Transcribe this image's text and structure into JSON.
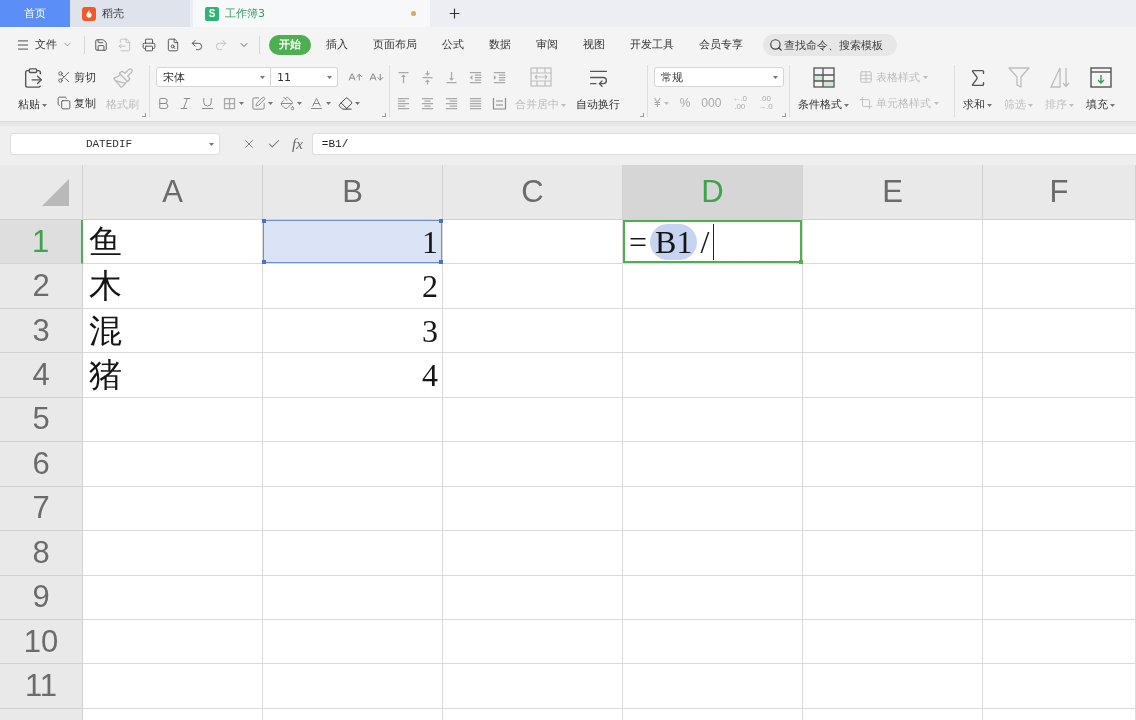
{
  "tabs": [
    {
      "kind": "home",
      "label": "首页",
      "selected": false
    },
    {
      "kind": "docer",
      "label": "稻壳",
      "selected": false
    },
    {
      "kind": "sheet",
      "logo": "S",
      "label": "工作簿3",
      "selected": true,
      "unsaved": true
    }
  ],
  "menu": {
    "file": "文件",
    "quick_access": [
      {
        "kind": "save",
        "disabled": false
      },
      {
        "kind": "export",
        "disabled": true
      },
      {
        "kind": "print",
        "disabled": false
      },
      {
        "kind": "preview",
        "disabled": false
      },
      {
        "kind": "undo",
        "disabled": false
      },
      {
        "kind": "redo",
        "disabled": true
      }
    ],
    "tabs": [
      {
        "label": "开始",
        "selected": true
      },
      {
        "label": "插入",
        "selected": false
      },
      {
        "label": "页面布局",
        "selected": false
      },
      {
        "label": "公式",
        "selected": false
      },
      {
        "label": "数据",
        "selected": false
      },
      {
        "label": "审阅",
        "selected": false
      },
      {
        "label": "视图",
        "selected": false
      },
      {
        "label": "开发工具",
        "selected": false
      },
      {
        "label": "会员专享",
        "selected": false
      }
    ],
    "search": {
      "placeholder": "查找命令、搜索模板"
    }
  },
  "ribbon": {
    "clipboard": [
      {
        "kind": "paste",
        "label": "粘贴",
        "disabled": false
      },
      {
        "kind": "cut",
        "label": "剪切",
        "disabled": false
      },
      {
        "kind": "copy",
        "label": "复制",
        "disabled": false
      },
      {
        "kind": "format_painter",
        "label": "格式刷",
        "disabled": true
      }
    ],
    "font": {
      "name": "宋体",
      "size": "11"
    },
    "alignment": [
      {
        "kind": "merge",
        "label": "合并居中",
        "disabled": true
      },
      {
        "kind": "wrap",
        "label": "自动换行",
        "disabled": false
      }
    ],
    "number": {
      "format": "常规",
      "symbols": [
        {
          "kind": "currency",
          "text": "¥"
        },
        {
          "kind": "percent",
          "text": "%"
        },
        {
          "kind": "thousands",
          "text": "000"
        },
        {
          "kind": "add_decimal",
          "text": "←.0",
          "subtext": ".00"
        },
        {
          "kind": "remove_decimal",
          "text": ".00",
          "subtext": "→.0"
        }
      ]
    },
    "styles": [
      {
        "kind": "conditional",
        "label": "条件格式",
        "disabled": false
      },
      {
        "kind": "table",
        "label": "表格样式",
        "disabled": true
      },
      {
        "kind": "cell",
        "label": "单元格样式",
        "disabled": true
      }
    ],
    "editing": [
      {
        "kind": "sum",
        "label": "求和",
        "disabled": false
      },
      {
        "kind": "filter",
        "label": "筛选",
        "disabled": true
      },
      {
        "kind": "sort",
        "label": "排序",
        "disabled": true
      },
      {
        "kind": "fill",
        "label": "填充",
        "disabled": false
      }
    ]
  },
  "formula_bar": {
    "name_box": "DATEDIF",
    "function_label": "fx",
    "formula": "=B1/"
  },
  "sheet": {
    "columns": [
      {
        "label": "A",
        "selected": false
      },
      {
        "label": "B",
        "selected": false
      },
      {
        "label": "C",
        "selected": false
      },
      {
        "label": "D",
        "selected": true
      },
      {
        "label": "E",
        "selected": false
      },
      {
        "label": "F",
        "selected": false
      }
    ],
    "rows": [
      {
        "label": "1",
        "selected": true,
        "cells": {
          "a": {
            "kind": "text",
            "text": "鱼"
          },
          "b": {
            "kind": "number",
            "text": "1",
            "referenced": true
          }
        }
      },
      {
        "label": "2",
        "selected": false,
        "cells": {
          "a": {
            "kind": "text",
            "text": "木"
          },
          "b": {
            "kind": "number",
            "text": "2",
            "referenced": false
          }
        }
      },
      {
        "label": "3",
        "selected": false,
        "cells": {
          "a": {
            "kind": "text",
            "text": "混"
          },
          "b": {
            "kind": "number",
            "text": "3",
            "referenced": false
          }
        }
      },
      {
        "label": "4",
        "selected": false,
        "cells": {
          "a": {
            "kind": "text",
            "text": "猪"
          },
          "b": {
            "kind": "number",
            "text": "4",
            "referenced": false
          }
        }
      },
      {
        "label": "5",
        "selected": false
      },
      {
        "label": "6",
        "selected": false
      },
      {
        "label": "7",
        "selected": false
      },
      {
        "label": "8",
        "selected": false
      },
      {
        "label": "9",
        "selected": false
      },
      {
        "label": "10",
        "selected": false
      },
      {
        "label": "11",
        "selected": false
      }
    ],
    "editor": {
      "parts": [
        {
          "kind": "operator",
          "text": "="
        },
        {
          "kind": "reference",
          "text": "B1"
        },
        {
          "kind": "operator",
          "text": "/"
        }
      ]
    }
  }
}
